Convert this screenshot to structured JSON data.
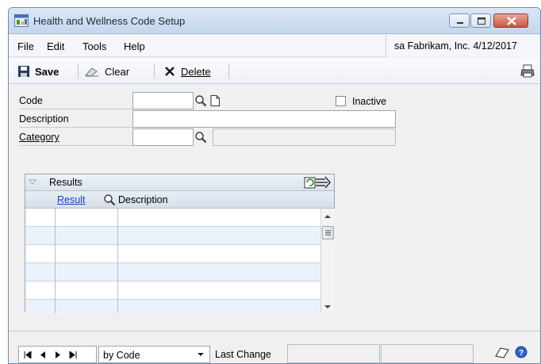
{
  "window": {
    "title": "Health and Wellness Code Setup",
    "icon": "app-window-icon"
  },
  "menu": {
    "items": [
      "File",
      "Edit",
      "Tools",
      "Help"
    ],
    "company_info": "sa  Fabrikam, Inc.  4/12/2017"
  },
  "toolbar": {
    "save_label": "Save",
    "clear_label": "Clear",
    "delete_label": "Delete"
  },
  "form": {
    "code_label": "Code",
    "code_value": "",
    "description_label": "Description",
    "description_value": "",
    "category_label": "Category",
    "category_value": "",
    "category_description_value": "",
    "inactive_label": "Inactive",
    "inactive_checked": false
  },
  "results": {
    "title": "Results",
    "columns": [
      "Result",
      "Description"
    ],
    "rows": [
      {
        "result": "",
        "description": ""
      },
      {
        "result": "",
        "description": ""
      },
      {
        "result": "",
        "description": ""
      },
      {
        "result": "",
        "description": ""
      },
      {
        "result": "",
        "description": ""
      },
      {
        "result": "",
        "description": ""
      }
    ]
  },
  "status": {
    "sort_by": "by Code",
    "last_change_label": "Last Change",
    "last_change_value": "",
    "last_change_user": ""
  },
  "colors": {
    "title_gradient_top": "#dbe7f5",
    "grid_alt_row": "#eaf3fb",
    "link": "#1a3fc7",
    "close_button": "#c75742"
  }
}
